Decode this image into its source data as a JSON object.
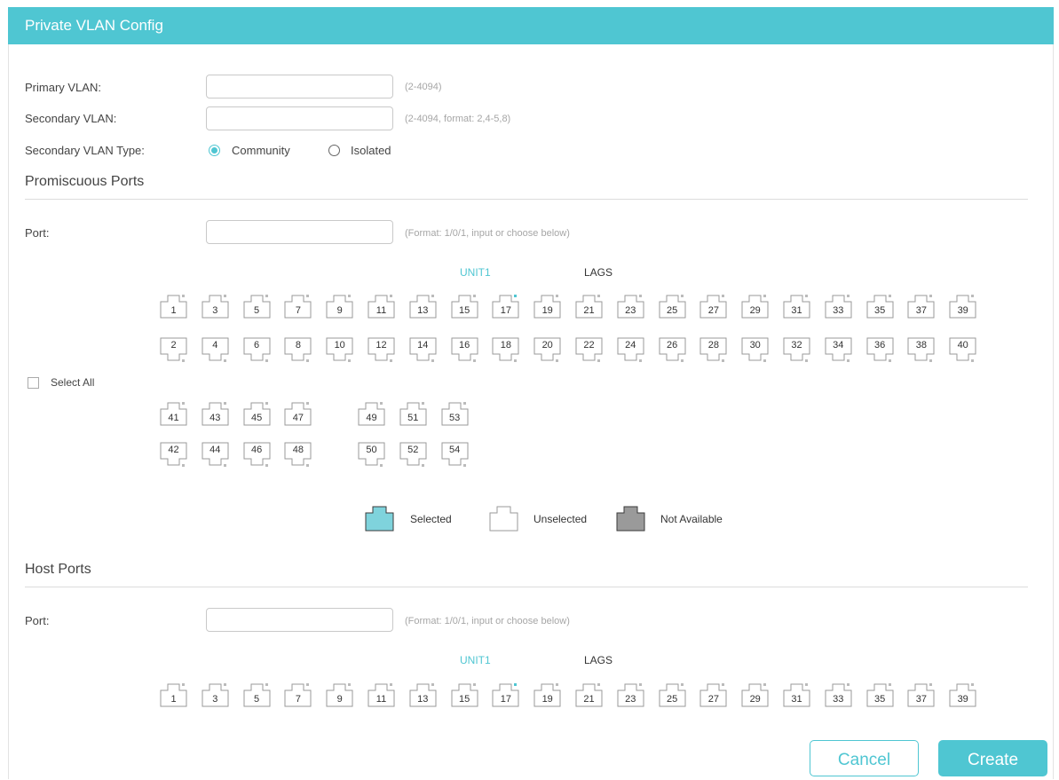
{
  "header": {
    "title": "Private VLAN Config"
  },
  "form": {
    "primary_vlan": {
      "label": "Primary VLAN:",
      "value": "",
      "hint": "(2-4094)"
    },
    "secondary_vlan": {
      "label": "Secondary VLAN:",
      "value": "",
      "hint": "(2-4094, format: 2,4-5,8)"
    },
    "secondary_type": {
      "label": "Secondary VLAN Type:",
      "options": [
        "Community",
        "Isolated"
      ],
      "selected": "Community"
    }
  },
  "promiscuous": {
    "title": "Promiscuous Ports",
    "port_label": "Port:",
    "port_value": "",
    "port_hint": "(Format: 1/0/1, input or choose below)",
    "unit_label": "UNIT1",
    "lags_label": "LAGS",
    "select_all": "Select All",
    "ports_row_top": [
      "1",
      "3",
      "5",
      "7",
      "9",
      "11",
      "13",
      "15",
      "17",
      "19",
      "21",
      "23",
      "25",
      "27",
      "29",
      "31",
      "33",
      "35",
      "37",
      "39"
    ],
    "ports_row_bottom": [
      "2",
      "4",
      "6",
      "8",
      "10",
      "12",
      "14",
      "16",
      "18",
      "20",
      "22",
      "24",
      "26",
      "28",
      "30",
      "32",
      "34",
      "36",
      "38",
      "40"
    ],
    "ports_group_a_top": [
      "41",
      "43",
      "45",
      "47"
    ],
    "ports_group_a_bottom": [
      "42",
      "44",
      "46",
      "48"
    ],
    "ports_group_b_top": [
      "49",
      "51",
      "53"
    ],
    "ports_group_b_bottom": [
      "50",
      "52",
      "54"
    ]
  },
  "legend": {
    "selected": "Selected",
    "unselected": "Unselected",
    "not_available": "Not Available"
  },
  "host": {
    "title": "Host Ports",
    "port_label": "Port:",
    "port_value": "",
    "port_hint": "(Format: 1/0/1, input or choose below)",
    "unit_label": "UNIT1",
    "lags_label": "LAGS",
    "ports_row_top": [
      "1",
      "3",
      "5",
      "7",
      "9",
      "11",
      "13",
      "15",
      "17",
      "19",
      "21",
      "23",
      "25",
      "27",
      "29",
      "31",
      "33",
      "35",
      "37",
      "39"
    ]
  },
  "buttons": {
    "cancel": "Cancel",
    "create": "Create"
  },
  "colors": {
    "accent": "#4fc6d2",
    "selected_port": "#7fd3dc",
    "unavailable_port": "#9a9a9a"
  }
}
